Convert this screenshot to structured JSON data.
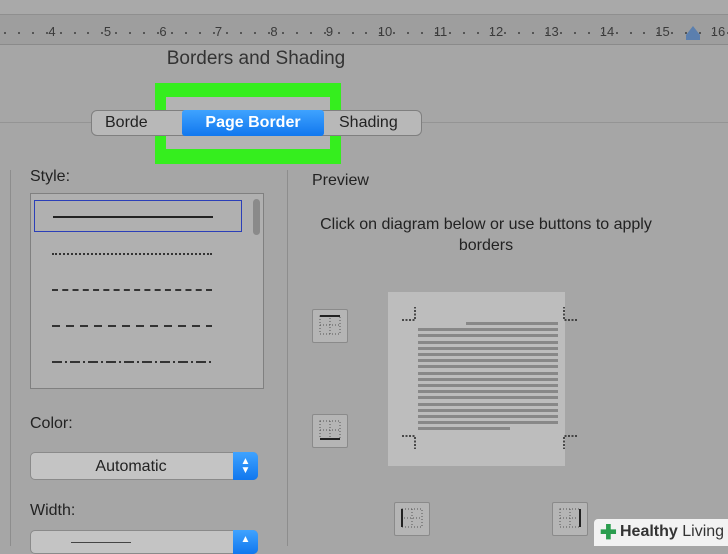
{
  "ruler": {
    "numbers": [
      "4",
      "5",
      "6",
      "7",
      "8",
      "9",
      "10",
      "11",
      "12",
      "13",
      "14",
      "15",
      "16"
    ]
  },
  "dialog": {
    "title": "Borders and Shading",
    "tabs": [
      {
        "label": "Borde",
        "active": false
      },
      {
        "label": "Page Border",
        "active": true
      },
      {
        "label": "Shading",
        "active": false
      }
    ]
  },
  "left_panel": {
    "style_label": "Style:",
    "color_label": "Color:",
    "color_value": "Automatic",
    "width_label": "Width:"
  },
  "preview": {
    "label": "Preview",
    "instruction": "Click on diagram below or use buttons to apply borders"
  },
  "colors": {
    "highlight": "#35ee1e",
    "active_tab": "#1a84f5"
  },
  "watermark": {
    "brand": "Healthy",
    "brand2": "Living"
  }
}
